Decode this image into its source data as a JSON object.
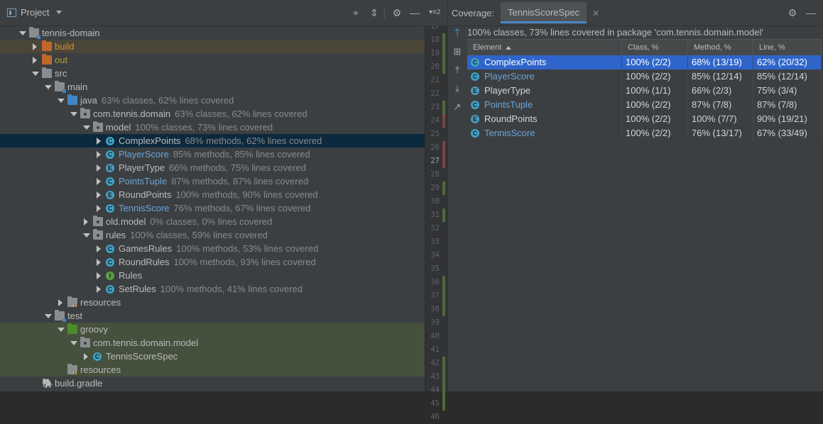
{
  "project": {
    "title": "Project",
    "tools": [
      "crosshair-icon",
      "collapse-icon",
      "gear-icon",
      "minimize-icon"
    ],
    "tree": [
      {
        "label": "tennis-domain",
        "coverage": "",
        "icon": "module-folder",
        "twisty": "open",
        "color": "normal",
        "bg": "none",
        "indent": 0
      },
      {
        "label": "build",
        "coverage": "",
        "icon": "orange-folder",
        "twisty": "closed",
        "color": "orange",
        "bg": "build",
        "indent": 1
      },
      {
        "label": "out",
        "coverage": "",
        "icon": "orange-folder",
        "twisty": "closed",
        "color": "olive",
        "bg": "none",
        "indent": 1
      },
      {
        "label": "src",
        "coverage": "",
        "icon": "folder",
        "twisty": "open",
        "color": "normal",
        "bg": "none",
        "indent": 1
      },
      {
        "label": "main",
        "coverage": "",
        "icon": "module-folder",
        "twisty": "open",
        "color": "normal",
        "bg": "none",
        "indent": 2
      },
      {
        "label": "java",
        "coverage": "63% classes, 62% lines covered",
        "icon": "blue-folder",
        "twisty": "open",
        "color": "normal",
        "bg": "none",
        "indent": 3
      },
      {
        "label": "com.tennis.domain",
        "coverage": "63% classes, 62% lines covered",
        "icon": "package",
        "twisty": "open",
        "color": "normal",
        "bg": "none",
        "indent": 4
      },
      {
        "label": "model",
        "coverage": "100% classes, 73% lines covered",
        "icon": "package",
        "twisty": "open",
        "color": "normal",
        "bg": "none",
        "indent": 5
      },
      {
        "label": "ComplexPoints",
        "coverage": "68% methods, 62% lines covered",
        "icon": "C",
        "twisty": "closed",
        "color": "normal",
        "bg": "selected",
        "indent": 6
      },
      {
        "label": "PlayerScore",
        "coverage": "85% methods, 85% lines covered",
        "icon": "C",
        "twisty": "closed",
        "color": "blue",
        "bg": "none",
        "indent": 6
      },
      {
        "label": "PlayerType",
        "coverage": "66% methods, 75% lines covered",
        "icon": "E",
        "twisty": "closed",
        "color": "normal",
        "bg": "none",
        "indent": 6
      },
      {
        "label": "PointsTuple",
        "coverage": "87% methods, 87% lines covered",
        "icon": "C",
        "twisty": "closed",
        "color": "blue",
        "bg": "none",
        "indent": 6
      },
      {
        "label": "RoundPoints",
        "coverage": "100% methods, 90% lines covered",
        "icon": "E",
        "twisty": "closed",
        "color": "normal",
        "bg": "none",
        "indent": 6
      },
      {
        "label": "TennisScore",
        "coverage": "76% methods, 67% lines covered",
        "icon": "C",
        "twisty": "closed",
        "color": "blue",
        "bg": "none",
        "indent": 6
      },
      {
        "label": "old.model",
        "coverage": "0% classes, 0% lines covered",
        "icon": "package",
        "twisty": "closed",
        "color": "normal",
        "bg": "none",
        "indent": 5
      },
      {
        "label": "rules",
        "coverage": "100% classes, 59% lines covered",
        "icon": "package",
        "twisty": "open",
        "color": "normal",
        "bg": "none",
        "indent": 5
      },
      {
        "label": "GamesRules",
        "coverage": "100% methods, 53% lines covered",
        "icon": "C",
        "twisty": "closed",
        "color": "normal",
        "bg": "none",
        "indent": 6
      },
      {
        "label": "RoundRules",
        "coverage": "100% methods, 93% lines covered",
        "icon": "C",
        "twisty": "closed",
        "color": "normal",
        "bg": "none",
        "indent": 6
      },
      {
        "label": "Rules",
        "coverage": "",
        "icon": "I",
        "twisty": "closed",
        "color": "normal",
        "bg": "none",
        "indent": 6
      },
      {
        "label": "SetRules",
        "coverage": "100% methods, 41% lines covered",
        "icon": "C",
        "twisty": "closed",
        "color": "normal",
        "bg": "none",
        "indent": 6
      },
      {
        "label": "resources",
        "coverage": "",
        "icon": "resources-folder",
        "twisty": "closed",
        "color": "normal",
        "bg": "none",
        "indent": 3
      },
      {
        "label": "test",
        "coverage": "",
        "icon": "module-folder",
        "twisty": "open",
        "color": "normal",
        "bg": "none",
        "indent": 2
      },
      {
        "label": "groovy",
        "coverage": "",
        "icon": "green-folder",
        "twisty": "open",
        "color": "normal",
        "bg": "test",
        "indent": 3
      },
      {
        "label": "com.tennis.domain.model",
        "coverage": "",
        "icon": "package",
        "twisty": "open",
        "color": "normal",
        "bg": "test",
        "indent": 4
      },
      {
        "label": "TennisScoreSpec",
        "coverage": "",
        "icon": "C",
        "twisty": "closed",
        "color": "normal",
        "bg": "test",
        "indent": 5
      },
      {
        "label": "resources",
        "coverage": "",
        "icon": "resources-folder",
        "twisty": "none",
        "color": "normal",
        "bg": "test",
        "indent": 3
      },
      {
        "label": "build.gradle",
        "coverage": "",
        "icon": "gradle",
        "twisty": "none",
        "color": "normal",
        "bg": "none",
        "indent": 1
      }
    ]
  },
  "gutter": {
    "lines": [
      "17",
      "18",
      "19",
      "20",
      "21",
      "22",
      "23",
      "24",
      "25",
      "26",
      "27",
      "28",
      "29",
      "30",
      "31",
      "32",
      "33",
      "34",
      "35",
      "36",
      "37",
      "38",
      "39",
      "40",
      "41",
      "42",
      "43",
      "44",
      "45",
      "46"
    ],
    "current_line": "27",
    "marks": {
      "18": "g",
      "19": "g",
      "20": "g",
      "23": "g",
      "24": "r",
      "26": "r",
      "27": "r",
      "29": "g",
      "31": "g",
      "36": "g",
      "37": "g",
      "38": "g",
      "42": "g",
      "43": "g",
      "44": "g",
      "45": "g"
    }
  },
  "coverage": {
    "title": "Coverage:",
    "tab": "TennisScoreSpec",
    "summary": "100% classes, 73% lines covered in package 'com.tennis.domain.model'",
    "columns": [
      "Element",
      "Class, %",
      "Method, %",
      "Line, %"
    ],
    "rows": [
      {
        "element": "ComplexPoints",
        "icon": "C",
        "class_pct": "100% (2/2)",
        "method_pct": "68% (13/19)",
        "line_pct": "62% (20/32)",
        "color": "normal",
        "selected": true
      },
      {
        "element": "PlayerScore",
        "icon": "C",
        "class_pct": "100% (2/2)",
        "method_pct": "85% (12/14)",
        "line_pct": "85% (12/14)",
        "color": "blue",
        "selected": false
      },
      {
        "element": "PlayerType",
        "icon": "E",
        "class_pct": "100% (1/1)",
        "method_pct": "66% (2/3)",
        "line_pct": "75% (3/4)",
        "color": "normal",
        "selected": false
      },
      {
        "element": "PointsTuple",
        "icon": "C",
        "class_pct": "100% (2/2)",
        "method_pct": "87% (7/8)",
        "line_pct": "87% (7/8)",
        "color": "blue",
        "selected": false
      },
      {
        "element": "RoundPoints",
        "icon": "E",
        "class_pct": "100% (2/2)",
        "method_pct": "100% (7/7)",
        "line_pct": "90% (19/21)",
        "color": "normal",
        "selected": false
      },
      {
        "element": "TennisScore",
        "icon": "C",
        "class_pct": "100% (2/2)",
        "method_pct": "76% (13/17)",
        "line_pct": "67% (33/49)",
        "color": "blue",
        "selected": false
      }
    ],
    "side_tools": [
      "up-arrow-icon",
      "flatten-packages-icon",
      "generate-report-icon",
      "import-icon",
      "navigate-icon"
    ]
  },
  "colors": {
    "panel_bg": "#3c3f41",
    "selection_blue": "#2f65ca",
    "selection_dark": "#0d293e",
    "test_bg": "#45503d",
    "link_blue": "#6ba4d8",
    "build_orange": "#d08f3c"
  }
}
